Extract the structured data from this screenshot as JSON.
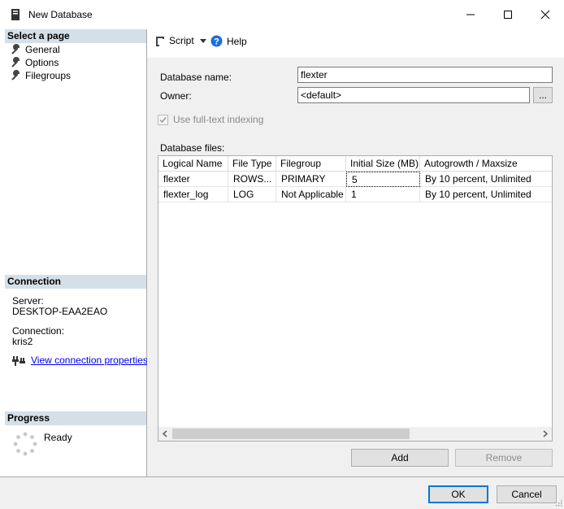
{
  "window": {
    "title": "New Database"
  },
  "left": {
    "select_page": "Select a page",
    "pages": [
      "General",
      "Options",
      "Filegroups"
    ],
    "connection_header": "Connection",
    "server_label": "Server:",
    "server_value": "DESKTOP-EAA2EAO",
    "connection_label": "Connection:",
    "connection_value": "kris2",
    "view_props": "View connection properties",
    "progress_header": "Progress",
    "progress_status": "Ready"
  },
  "toolbar": {
    "script": "Script",
    "help": "Help"
  },
  "form": {
    "db_name_label": "Database name:",
    "db_name_value": "flexter",
    "owner_label": "Owner:",
    "owner_value": "<default>",
    "owner_browse": "...",
    "fulltext_label": "Use full-text indexing",
    "db_files_label": "Database files:"
  },
  "grid": {
    "headers": [
      "Logical Name",
      "File Type",
      "Filegroup",
      "Initial Size (MB)",
      "Autogrowth / Maxsize"
    ],
    "rows": [
      [
        "flexter",
        "ROWS...",
        "PRIMARY",
        "5",
        "By 10 percent, Unlimited"
      ],
      [
        "flexter_log",
        "LOG",
        "Not Applicable",
        "1",
        "By 10 percent, Unlimited"
      ]
    ]
  },
  "buttons": {
    "add": "Add",
    "remove": "Remove",
    "ok": "OK",
    "cancel": "Cancel"
  },
  "colors": {
    "section_header": "#d5dfe8",
    "link": "#0000ee",
    "help_blue": "#1e6fd9"
  }
}
